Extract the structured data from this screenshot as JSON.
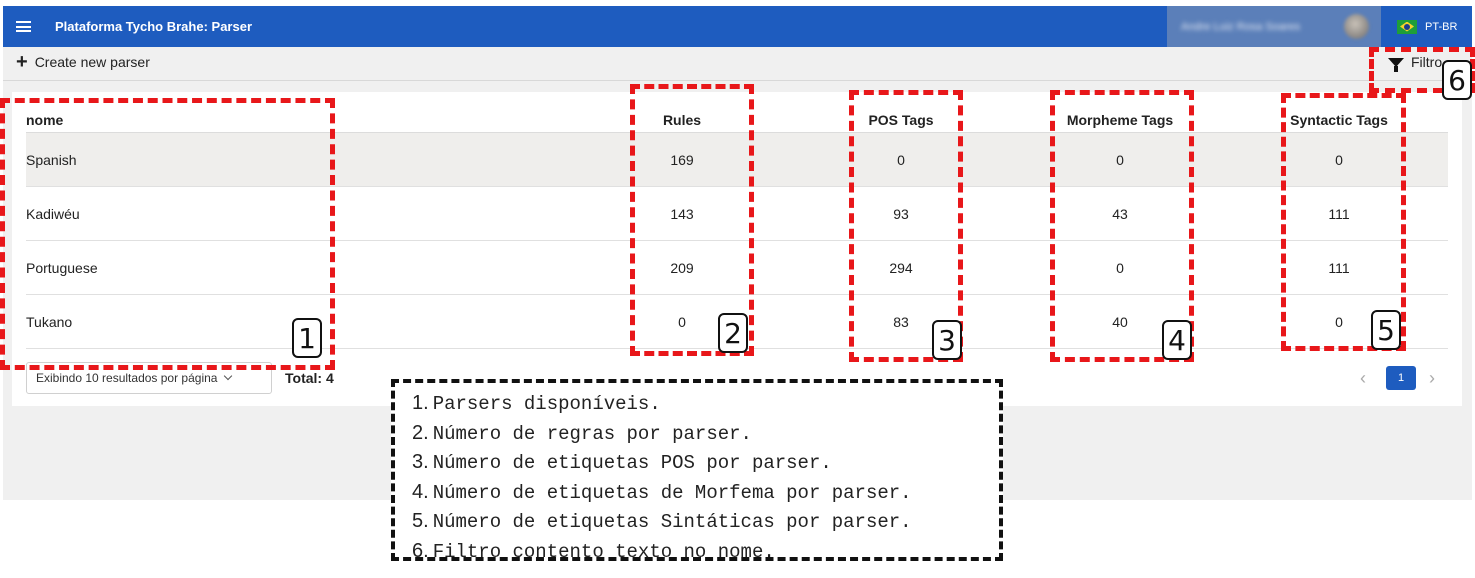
{
  "appbar": {
    "title": "Plataforma Tycho Brahe: Parser",
    "user_name": "Andre Luiz Rosa Soares",
    "language": "PT-BR"
  },
  "toolbar": {
    "create_label": "Create new parser",
    "filter_label": "Filtro"
  },
  "table": {
    "columns": [
      "nome",
      "Rules",
      "POS Tags",
      "Morpheme Tags",
      "Syntactic Tags"
    ],
    "rows": [
      {
        "name": "Spanish",
        "rules": "169",
        "pos": "0",
        "morpheme": "0",
        "syntactic": "0"
      },
      {
        "name": "Kadiwéu",
        "rules": "143",
        "pos": "93",
        "morpheme": "43",
        "syntactic": "111"
      },
      {
        "name": "Portuguese",
        "rules": "209",
        "pos": "294",
        "morpheme": "0",
        "syntactic": "111"
      },
      {
        "name": "Tukano",
        "rules": "0",
        "pos": "83",
        "morpheme": "40",
        "syntactic": "0"
      }
    ]
  },
  "pagination": {
    "per_page_label": "Exibindo 10 resultados por página",
    "total_label": "Total: 4",
    "current_page": "1",
    "prev": "‹",
    "next": "›"
  },
  "annotations": {
    "markers": [
      "1",
      "2",
      "3",
      "4",
      "5",
      "6"
    ],
    "legend": [
      {
        "n": "1.",
        "text": "Parsers disponíveis."
      },
      {
        "n": "2.",
        "text": "Número de regras por parser."
      },
      {
        "n": "3.",
        "text": "Número de etiquetas POS por parser."
      },
      {
        "n": "4.",
        "text": "Número de etiquetas de Morfema por parser."
      },
      {
        "n": "5.",
        "text": "Número de etiquetas Sintáticas por parser."
      },
      {
        "n": "6.",
        "text": "Filtro contento texto no nome."
      }
    ]
  },
  "colors": {
    "appbar": "#1e5cbf",
    "annotation_dash": "#e8171a",
    "row_highlight": "#efeeec"
  }
}
